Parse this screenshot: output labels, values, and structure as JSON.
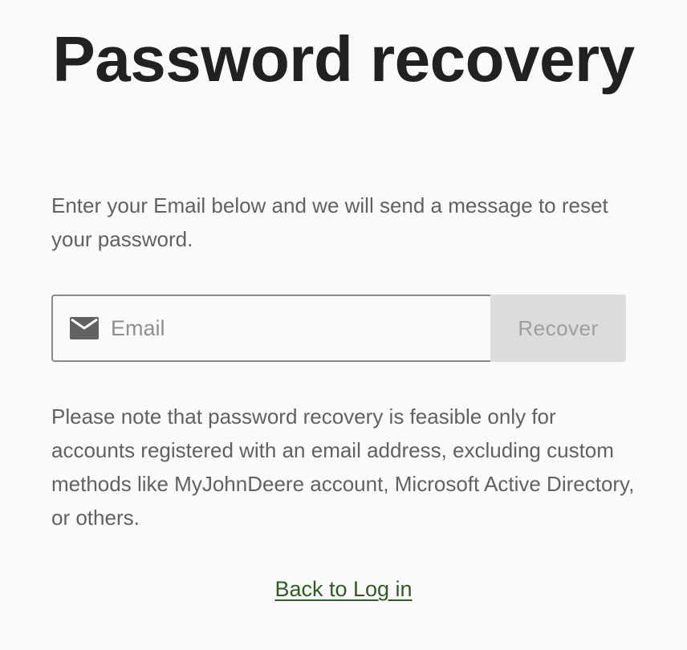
{
  "page": {
    "title": "Password recovery",
    "intro": "Enter your Email below and we will send a message to reset your password."
  },
  "form": {
    "email_placeholder": "Email",
    "email_value": "",
    "recover_label": "Recover",
    "icon": "mail-icon"
  },
  "note": "Please note that password recovery is feasible only for accounts registered with an email address, excluding custom methods like MyJohnDeere account, Microsoft Active Directory, or others.",
  "links": {
    "back_to_login": "Back to Log in"
  },
  "colors": {
    "background": "#fafafa",
    "title": "#212121",
    "body_text": "#616161",
    "button_bg": "#dcdcdc",
    "button_text": "#9e9e9e",
    "link": "#2e5d1f"
  }
}
